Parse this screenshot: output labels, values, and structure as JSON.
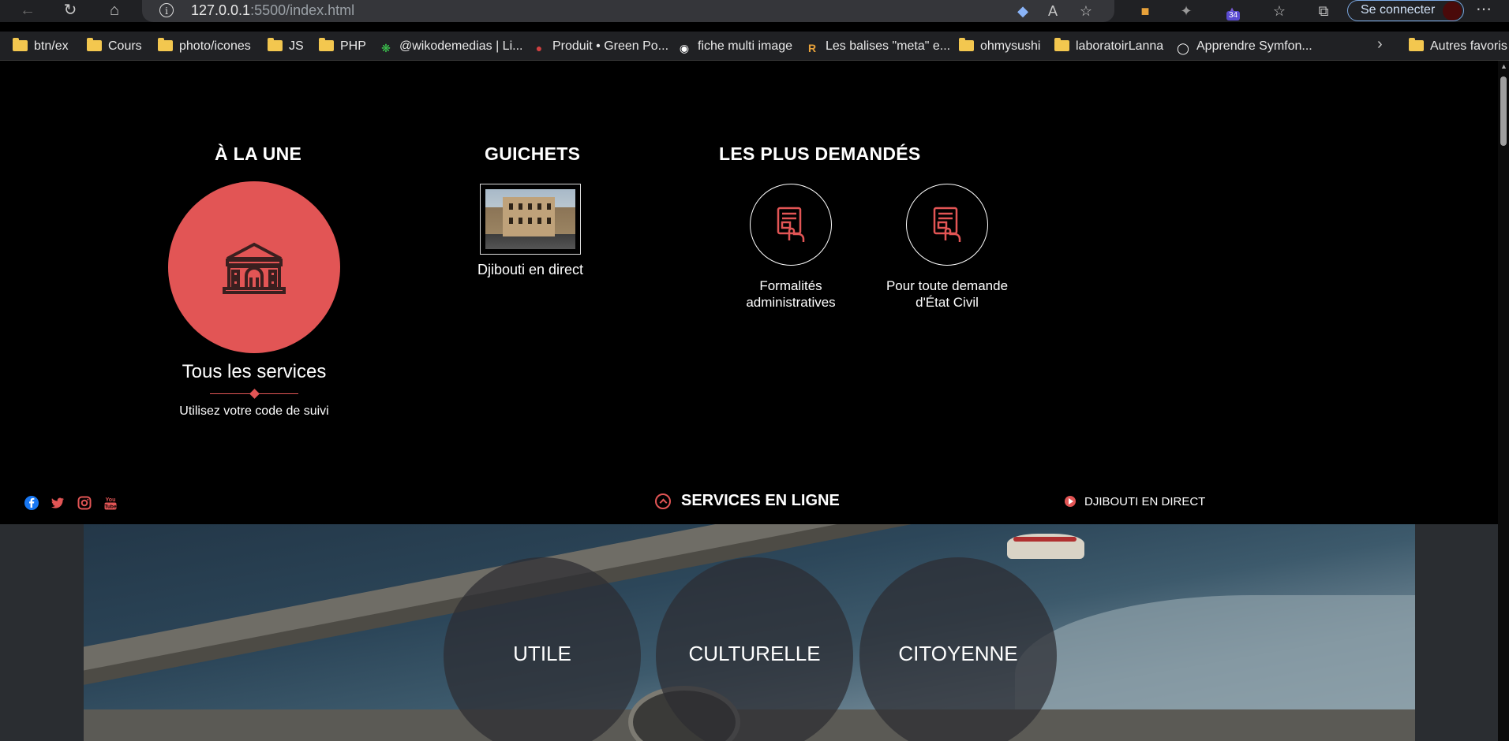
{
  "browser": {
    "url_host": "127.0.0.1",
    "url_rest": ":5500/index.html",
    "signin_label": "Se connecter",
    "ext_badge": "34",
    "bookmarks": [
      {
        "label": "btn/ex",
        "icon": "folder-icon"
      },
      {
        "label": "Cours",
        "icon": "folder-icon"
      },
      {
        "label": "photo/icones",
        "icon": "folder-icon"
      },
      {
        "label": "JS",
        "icon": "folder-icon"
      },
      {
        "label": "PHP",
        "icon": "folder-icon"
      },
      {
        "label": "@wikodemedias | Li...",
        "icon": "sparkle-icon"
      },
      {
        "label": "Produit • Green Po...",
        "icon": "site-icon"
      },
      {
        "label": "fiche multi image",
        "icon": "site-icon"
      },
      {
        "label": "Les balises \"meta\" e...",
        "icon": "site-icon"
      },
      {
        "label": "ohmysushi",
        "icon": "folder-icon"
      },
      {
        "label": "laboratoirLanna",
        "icon": "folder-icon"
      },
      {
        "label": "Apprendre Symfon...",
        "icon": "site-icon"
      },
      {
        "label": "Autres favoris",
        "icon": "folder-icon"
      }
    ]
  },
  "page": {
    "a_la_une": {
      "title": "À LA UNE",
      "link_label": "Tous les services",
      "subtitle": "Utilisez votre code de suivi",
      "accent": "#e25555"
    },
    "guichets": {
      "title": "GUICHETS",
      "item_label": "Djibouti en direct"
    },
    "plus_demandes": {
      "title": "LES PLUS DEMANDÉS",
      "items": [
        {
          "label_line1": "Formalités",
          "label_line2": "administratives"
        },
        {
          "label_line1": "Pour toute demande",
          "label_line2": "d'État Civil"
        }
      ]
    },
    "bar": {
      "services_label": "SERVICES EN LIGNE",
      "direct_label": "DJIBOUTI EN DIRECT",
      "social": [
        "facebook-icon",
        "twitter-icon",
        "instagram-icon",
        "youtube-icon"
      ]
    },
    "categories": [
      "UTILE",
      "CULTURELLE",
      "CITOYENNE"
    ]
  }
}
